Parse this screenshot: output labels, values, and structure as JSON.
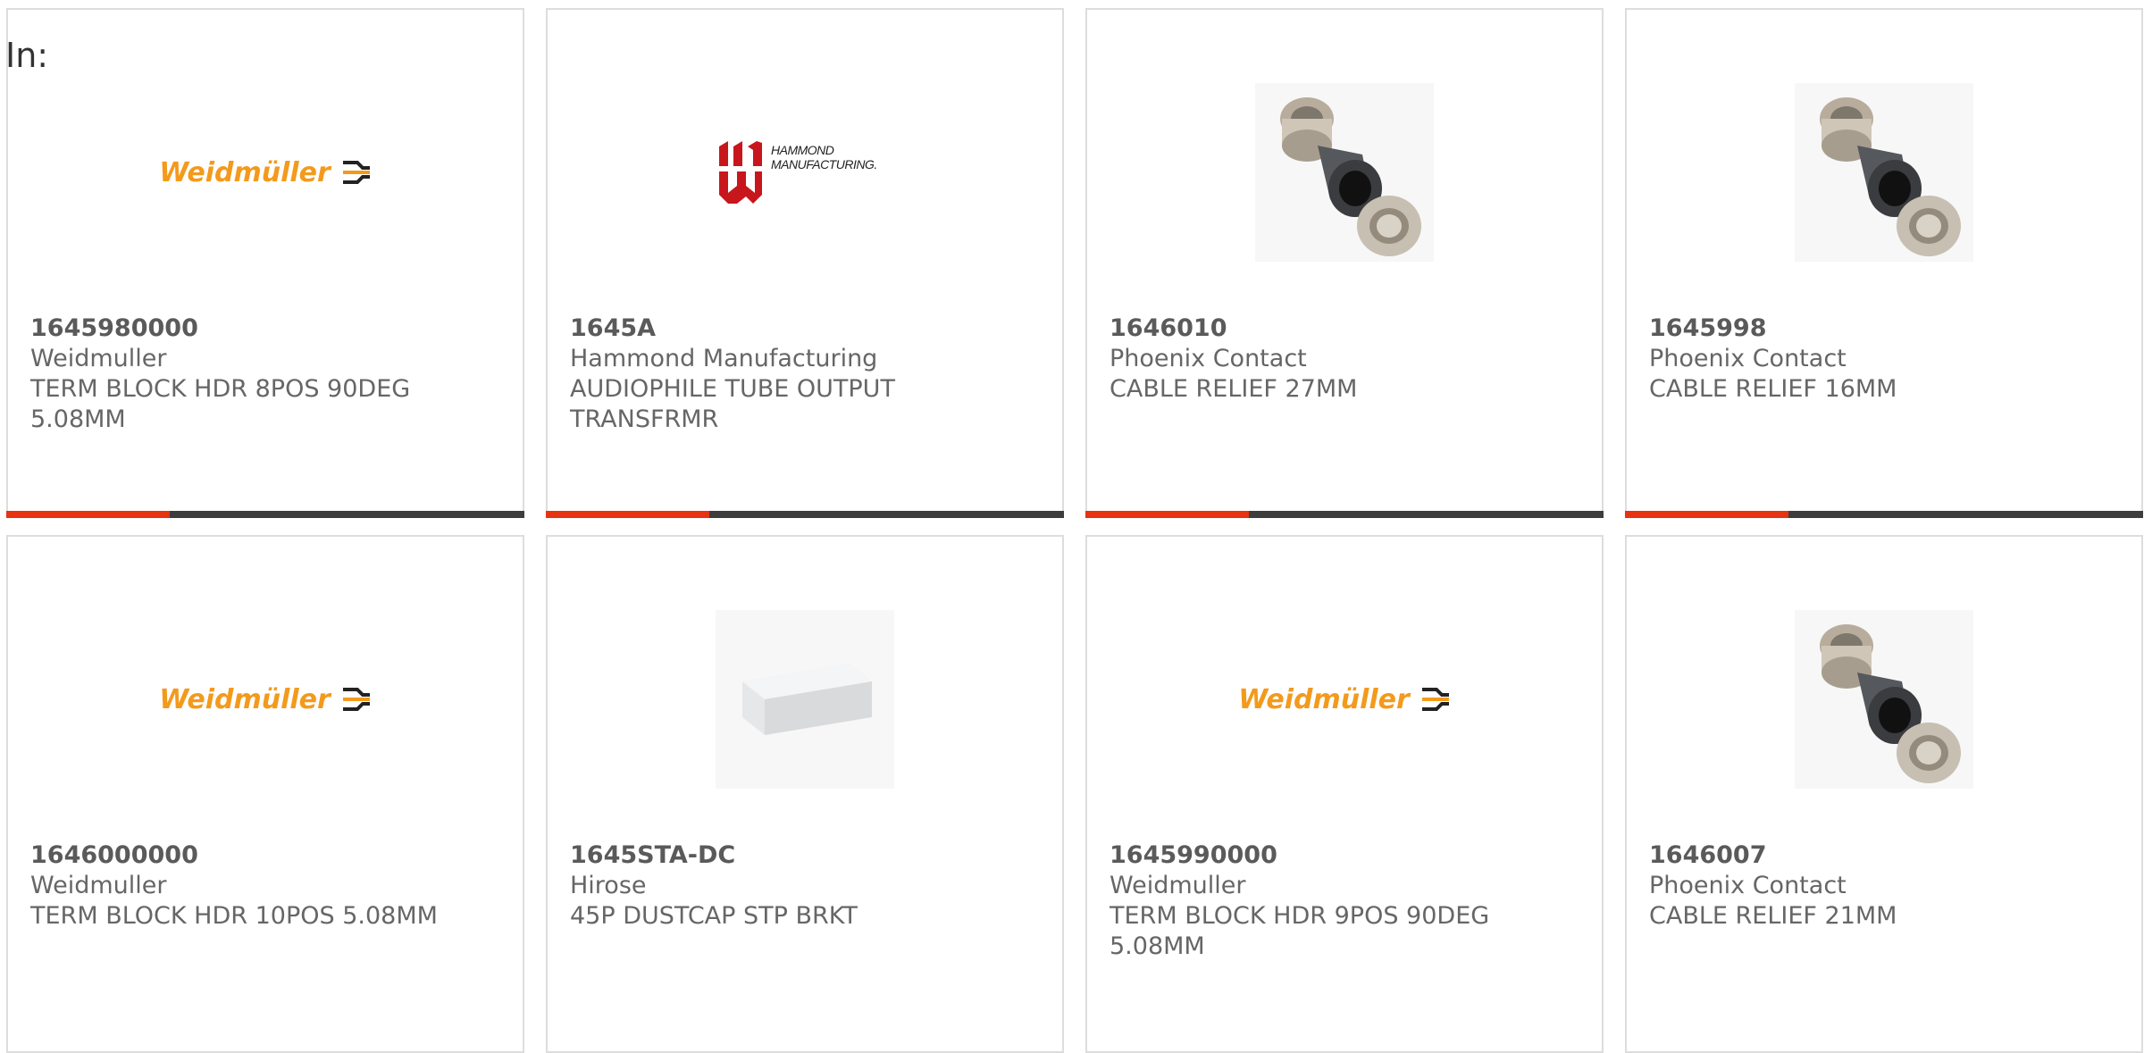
{
  "filter": {
    "label": "In:"
  },
  "products": [
    {
      "part_number": "1645980000",
      "manufacturer": "Weidmuller",
      "description": "TERM BLOCK HDR 8POS 90DEG 5.08MM",
      "image": "weidmuller-logo",
      "logo_text": "Weidmüller"
    },
    {
      "part_number": "1645A",
      "manufacturer": "Hammond Manufacturing",
      "description": "AUDIOPHILE TUBE OUTPUT TRANSFRMR",
      "image": "hammond-logo",
      "logo_text": "HAMMOND MANUFACTURING."
    },
    {
      "part_number": "1646010",
      "manufacturer": "Phoenix Contact",
      "description": "CABLE RELIEF 27MM",
      "image": "cable-gland-photo"
    },
    {
      "part_number": "1645998",
      "manufacturer": "Phoenix Contact",
      "description": "CABLE RELIEF 16MM",
      "image": "cable-gland-photo"
    },
    {
      "part_number": "1646000000",
      "manufacturer": "Weidmuller",
      "description": "TERM BLOCK HDR 10POS 5.08MM",
      "image": "weidmuller-logo",
      "logo_text": "Weidmüller"
    },
    {
      "part_number": "1645STA-DC",
      "manufacturer": "Hirose",
      "description": "45P DUSTCAP STP BRKT",
      "image": "dustcap-photo"
    },
    {
      "part_number": "1645990000",
      "manufacturer": "Weidmuller",
      "description": "TERM BLOCK HDR 9POS 90DEG 5.08MM",
      "image": "weidmuller-logo",
      "logo_text": "Weidmüller"
    },
    {
      "part_number": "1646007",
      "manufacturer": "Phoenix Contact",
      "description": "CABLE RELIEF 21MM",
      "image": "cable-gland-photo"
    }
  ],
  "colors": {
    "accent": "#e63312",
    "bar": "#3d3d3d",
    "weidmuller_orange": "#f39a1c",
    "hammond_red": "#c8161d"
  }
}
